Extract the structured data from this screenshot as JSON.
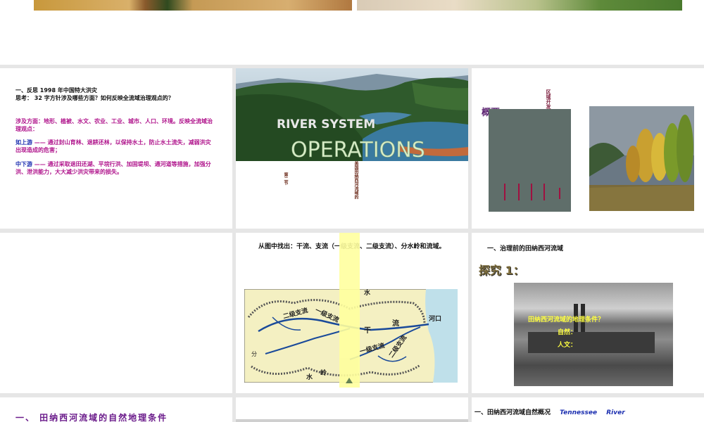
{
  "s1": {
    "line1": "一、反思 1998 年中国特大洪灾",
    "line2": "思考： 32 字方针涉及哪些方面？如何反映全流域治理观点的？",
    "aspects_label": "涉及方面：",
    "aspects_text": "地形、植被、水文、农业、工业、城市、人口、环境。反映全流域治理观点：",
    "upper_label": "如上游",
    "upper_text": " —— 通过封山育林、退耕还林，以保持水土，防止水土流失，减弱洪灾出现造成的危害；",
    "middle_label": "中下游",
    "middle_text": " —— 通过采取退田还湖、平垸行洪、加固堤坝、通河道等措施，加强分洪、泄洪能力，大大减少洪灾带来的损失。"
  },
  "s2": {
    "title_line1": "RIVER SYSTEM",
    "title_line2": "OPERATIONS",
    "vert1": "第二节",
    "vert2": "美国田纳西河流域的"
  },
  "s3": {
    "heading": "概要：",
    "vert_title": "区域开发与整治",
    "colors": {
      "panel": "#5f6e6a",
      "accent": "#a01040"
    }
  },
  "s5": {
    "question": "从图中找出：干流、支流（一级支流、二级支流）、分水岭和流域。",
    "map_labels": {
      "lvl1a": "一级支流",
      "lvl1b": "一级支流",
      "lvl2a": "二级支流",
      "lvl2b": "二级支流",
      "main_a": "干",
      "main_b": "流",
      "mouth": "河口",
      "divide_a": "分",
      "divide_b": "水",
      "divide_c": "岭",
      "water_a": "水"
    }
  },
  "s6": {
    "heading": "一、治理前的田纳西河流域",
    "explore": "探究 1：",
    "q1": "田纳西河流域的地理条件？",
    "q2": "自然：",
    "q3": "人文："
  },
  "s7": {
    "heading": "一、 田纳西河流域的自然地理条件"
  },
  "s9": {
    "heading": "一、田纳西河流域自然概况",
    "en1": "Tennessee",
    "en2": "River"
  }
}
